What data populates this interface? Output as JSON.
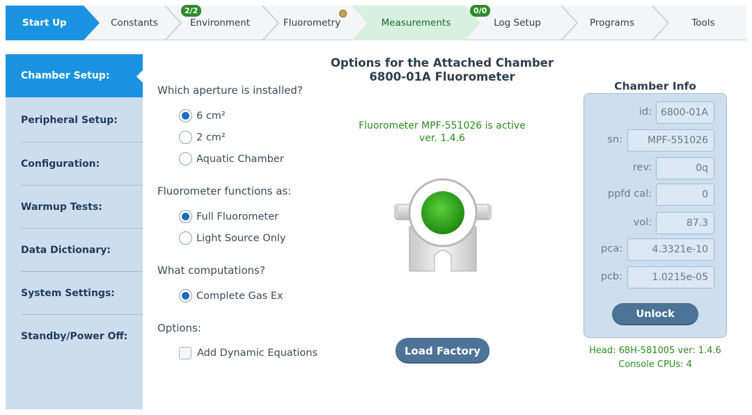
{
  "tabs": {
    "start_up": "Start Up",
    "constants": "Constants",
    "environment": "Environment",
    "environment_badge": "2/2",
    "fluorometry": "Fluorometry",
    "measurements": "Measurements",
    "log_setup": "Log Setup",
    "log_badge": "0/0",
    "programs": "Programs",
    "tools": "Tools"
  },
  "sidebar": {
    "items": [
      {
        "label": "Chamber Setup:",
        "active": true
      },
      {
        "label": "Peripheral Setup:"
      },
      {
        "label": "Configuration:"
      },
      {
        "label": "Warmup Tests:"
      },
      {
        "label": "Data Dictionary:"
      },
      {
        "label": "System Settings:"
      },
      {
        "label": "Standby/Power Off:"
      }
    ]
  },
  "main": {
    "title_line1": "Options for the Attached Chamber",
    "title_line2": "6800-01A Fluorometer",
    "aperture_heading": "Which aperture is installed?",
    "aperture_options": [
      "6 cm²",
      "2 cm²",
      "Aquatic Chamber"
    ],
    "aperture_selected": "6 cm²",
    "fluor_heading": "Fluorometer functions as:",
    "fluor_options": [
      "Full Fluorometer",
      "Light Source Only"
    ],
    "fluor_selected": "Full Fluorometer",
    "comp_heading": "What computations?",
    "comp_options": [
      "Complete Gas Ex"
    ],
    "comp_selected": "Complete Gas Ex",
    "options_heading": "Options:",
    "dynamic_equations_label": "Add Dynamic Equations",
    "dynamic_equations_checked": false,
    "status_line1": "Fluorometer MPF-551026 is active",
    "status_line2": "ver. 1.4.6",
    "load_factory_label": "Load Factory"
  },
  "chamber_info": {
    "title": "Chamber Info",
    "fields": [
      {
        "label": "id:",
        "value": "6800-01A"
      },
      {
        "label": "sn:",
        "value": "MPF-551026"
      },
      {
        "label": "rev:",
        "value": "0q"
      },
      {
        "label": "ppfd cal:",
        "value": "0"
      },
      {
        "label": "vol:",
        "value": "87.3"
      },
      {
        "label": "pca:",
        "value": "4.3321e-10"
      },
      {
        "label": "pcb:",
        "value": "1.0215e-05"
      }
    ],
    "unlock_label": "Unlock",
    "head_info": "Head: 68H-581005 ver: 1.4.6",
    "console_info": "Console CPUs: 4"
  },
  "colors": {
    "accent_blue": "#1a94e0",
    "sidebar_bg": "#ccddee",
    "status_green": "#2a8a1e",
    "button_blue": "#4d7397"
  },
  "icons": {
    "chamber_status": "fluorometer-chamber-icon",
    "status_light": "green"
  }
}
